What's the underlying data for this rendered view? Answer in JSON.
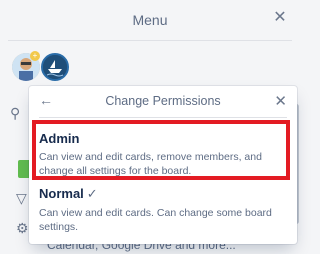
{
  "menu": {
    "title": "Menu",
    "close_icon": "close-icon"
  },
  "background": {
    "avatars": [
      "member-avatar",
      "member-avatar-boat"
    ],
    "partial_text": "Calendar, Google Drive and more..."
  },
  "popover": {
    "title": "Change Permissions",
    "back_icon": "arrow-left-icon",
    "close_icon": "close-icon",
    "options": [
      {
        "name": "Admin",
        "description": "Can view and edit cards, remove members, and change all settings for the board.",
        "highlighted": true
      },
      {
        "name": "Normal",
        "checkmark": "✓",
        "description": "Can view and edit cards. Can change some board settings.",
        "selected": true
      }
    ]
  },
  "colors": {
    "highlight": "#e31b23",
    "accent_green": "#61bd4f"
  }
}
